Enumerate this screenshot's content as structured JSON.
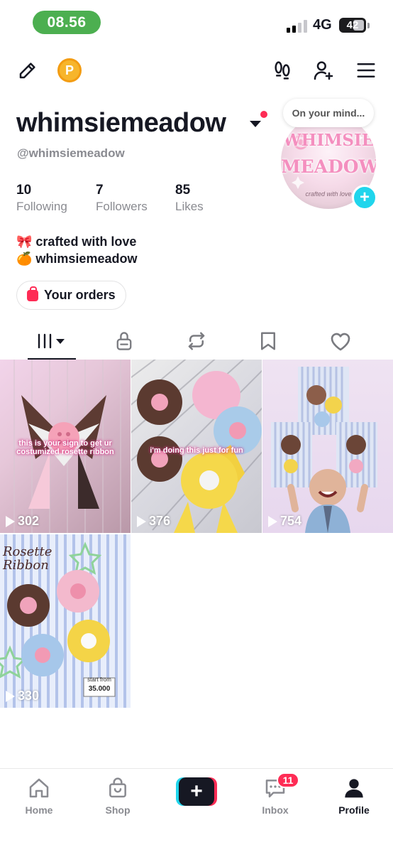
{
  "status_bar": {
    "time": "08.56",
    "network": "4G",
    "battery": "42"
  },
  "profile": {
    "display_name": "whimsiemeadow",
    "username": "@whimsiemeadow",
    "thought_bubble": "On your mind...",
    "avatar_text": {
      "line1": "WHIMSIE",
      "line2": "MEADOW",
      "line3": "crafted with love"
    },
    "stats": [
      {
        "value": "10",
        "label": "Following"
      },
      {
        "value": "7",
        "label": "Followers"
      },
      {
        "value": "85",
        "label": "Likes"
      }
    ],
    "bio": [
      "🎀 crafted with love",
      "🍊 whimsiemeadow"
    ],
    "orders_button": "Your orders"
  },
  "tabs": [
    "videos-icon",
    "lock-icon",
    "repost-icon",
    "bookmark-icon",
    "heart-icon"
  ],
  "videos": [
    {
      "views": "302",
      "caption": "this is your sign to get ur costumized rosette ribbon"
    },
    {
      "views": "376",
      "caption": "i'm doing this just for fun"
    },
    {
      "views": "754",
      "caption": ""
    },
    {
      "views": "330",
      "caption": "Rosette Ribbon",
      "price_label": "start from",
      "price": "35.000"
    }
  ],
  "bottom_nav": {
    "home": "Home",
    "shop": "Shop",
    "inbox": "Inbox",
    "inbox_badge": "11",
    "profile": "Profile"
  },
  "colors": {
    "accent_red": "#fe2c55",
    "accent_cyan": "#20d5ec",
    "text": "#161823",
    "muted": "#8a8b91"
  }
}
